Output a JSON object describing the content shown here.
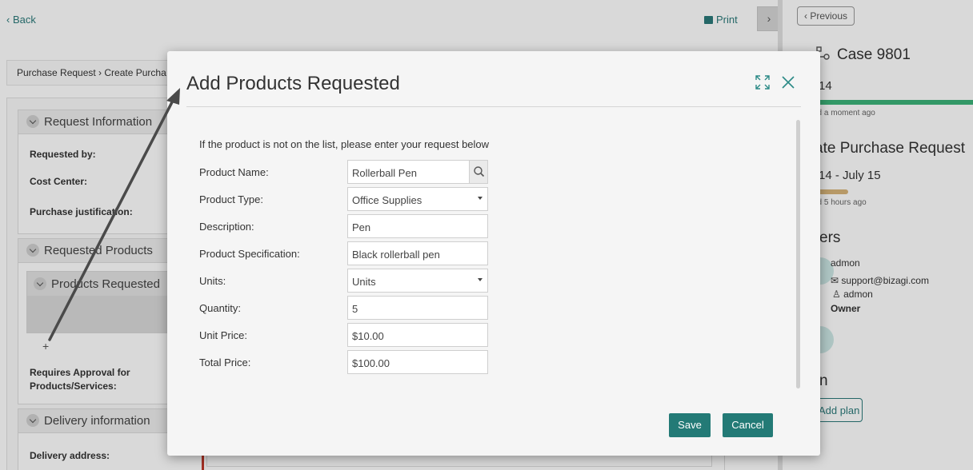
{
  "topbar": {
    "back_label": "Back",
    "print_label": "Print"
  },
  "breadcrumb": "Purchase Request › Create Purcha",
  "sections": {
    "request_information": {
      "title": "Request Information",
      "labels": [
        "Requested by:",
        "Cost Center:",
        "Purchase justification:"
      ]
    },
    "requested_products": {
      "title": "Requested Products",
      "sub_title": "Products Requested",
      "approval_label_line1": "Requires Approval for",
      "approval_label_line2": "Products/Services:"
    },
    "delivery_information": {
      "title": "Delivery information",
      "address_label": "Delivery address:"
    }
  },
  "right_panel": {
    "previous_label": "Previous",
    "case_title": "Case 9801",
    "case_num": "14",
    "case_updated": "ed a moment ago",
    "task_title": "ate Purchase Request",
    "task_dates": "14 - July 15",
    "task_updated": "ed 5 hours ago",
    "users_heading": "ers",
    "user_name": "admon",
    "user_email": "support@bizagi.com",
    "user_login": "admon",
    "user_role": "Owner",
    "plan_heading": "n",
    "add_plan_label": "Add plan"
  },
  "modal": {
    "title": "Add Products Requested",
    "intro": "If the product is not on the list, please enter your request below",
    "fields": {
      "product_name": {
        "label": "Product Name:",
        "value": "Rollerball Pen"
      },
      "product_type": {
        "label": "Product Type:",
        "value": "Office Supplies"
      },
      "description": {
        "label": "Description:",
        "value": "Pen"
      },
      "product_spec": {
        "label": "Product Specification:",
        "value": "Black rollerball pen"
      },
      "units": {
        "label": "Units:",
        "value": "Units"
      },
      "quantity": {
        "label": "Quantity:",
        "value": "5"
      },
      "unit_price": {
        "label": "Unit Price:",
        "value": "$10.00"
      },
      "total_price": {
        "label": "Total Price:",
        "value": "$100.00"
      }
    },
    "save_label": "Save",
    "cancel_label": "Cancel"
  },
  "colors": {
    "accent": "#237a76",
    "progress_green": "#3db37a",
    "progress_tan": "#d8b47a"
  },
  "icons": [
    "chevron-left-icon",
    "printer-icon",
    "chevron-right-icon",
    "expand-icon",
    "close-icon",
    "search-icon",
    "caret-down-icon",
    "plus-icon",
    "email-icon",
    "user-icon",
    "hierarchy-icon"
  ]
}
